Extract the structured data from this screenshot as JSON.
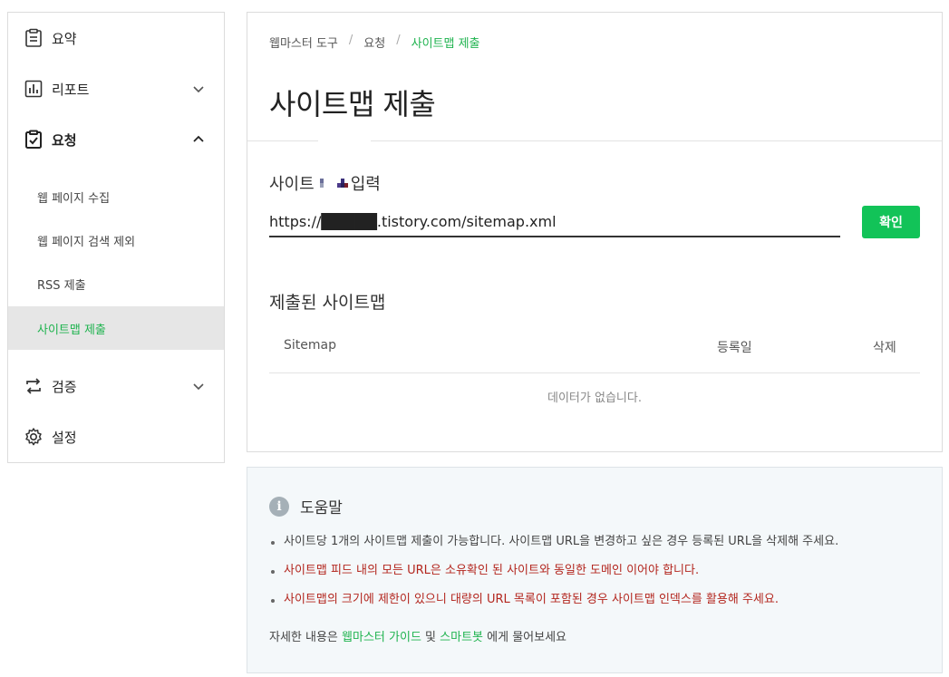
{
  "sidebar": {
    "summary": "요약",
    "report": "리포트",
    "request": "요청",
    "request_subitems": [
      "웹 페이지 수집",
      "웹 페이지 검색 제외",
      "RSS 제출",
      "사이트맵 제출"
    ],
    "verify": "검증",
    "settings": "설정"
  },
  "breadcrumb": {
    "root": "웹마스터 도구",
    "sep": "/",
    "parent": "요청",
    "current": "사이트맵 제출"
  },
  "page_title": "사이트맵 제출",
  "form": {
    "label_prefix": "사이트",
    "label_suffix": "입력",
    "url_value": "https://█████.tistory.com/sitemap.xml",
    "confirm_label": "확인"
  },
  "submitted": {
    "title": "제출된 사이트맵",
    "columns": [
      "Sitemap",
      "등록일",
      "삭제"
    ],
    "empty_text": "데이터가 없습니다."
  },
  "help": {
    "title": "도움말",
    "bullets": [
      "사이트당 1개의 사이트맵 제출이 가능합니다. 사이트맵 URL을 변경하고 싶은 경우 등록된 URL을 삭제해 주세요.",
      "사이트맵 피드 내의 모든 URL은 소유확인 된 사이트와 동일한 도메인 이어야 합니다.",
      "사이트맵의 크기에 제한이 있으니 대량의 URL 목록이 포함된 경우 사이트맵 인덱스를 활용해 주세요."
    ],
    "footer_prefix": "자세한 내용은",
    "guide_link": "웹마스터 가이드",
    "and": "및",
    "chatbot_link": "스마트봇",
    "footer_suffix": "에게 물어보세요"
  },
  "colors": {
    "accent_green": "#12c358",
    "link_green": "#1fb34f",
    "warning_red": "#b3261e"
  }
}
